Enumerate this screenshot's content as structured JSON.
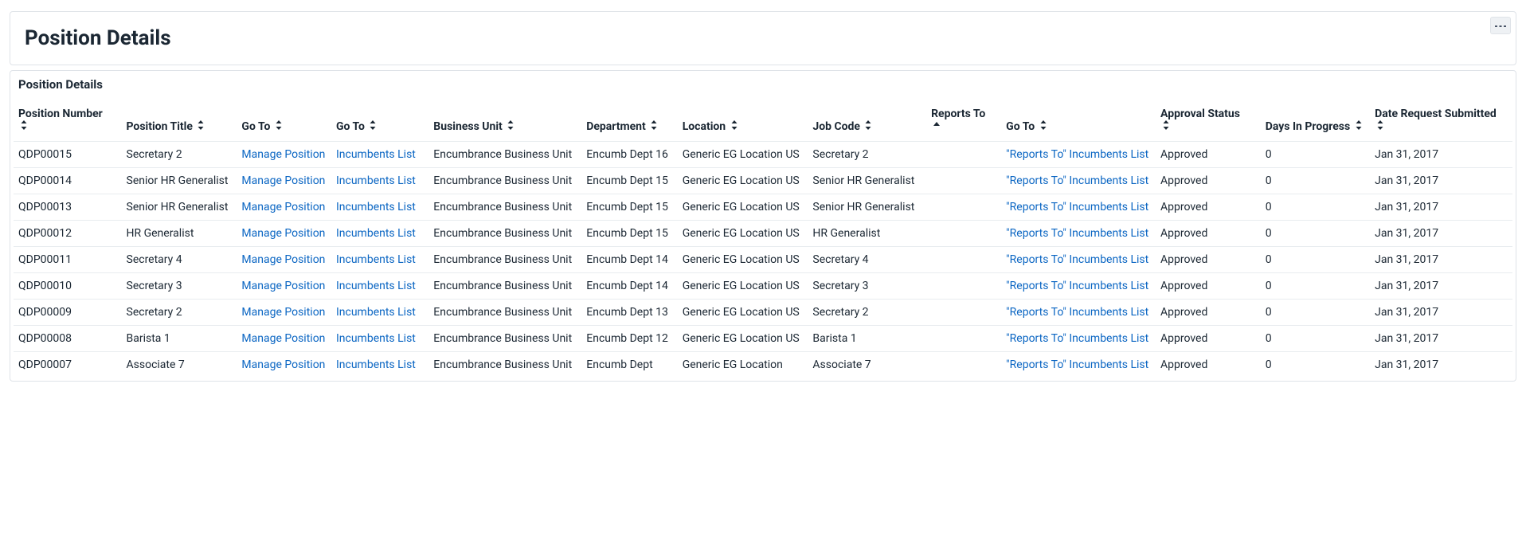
{
  "page": {
    "title": "Position Details",
    "grid_title": "Position Details"
  },
  "columns": [
    {
      "key": "position_number",
      "label": "Position Number",
      "sort": "both",
      "break": true
    },
    {
      "key": "position_title",
      "label": "Position Title",
      "sort": "both"
    },
    {
      "key": "goto1",
      "label": "Go To",
      "sort": "both"
    },
    {
      "key": "goto2",
      "label": "Go To",
      "sort": "both"
    },
    {
      "key": "business_unit",
      "label": "Business Unit",
      "sort": "both"
    },
    {
      "key": "department",
      "label": "Department",
      "sort": "both"
    },
    {
      "key": "location",
      "label": "Location",
      "sort": "both"
    },
    {
      "key": "job_code",
      "label": "Job Code",
      "sort": "both"
    },
    {
      "key": "reports_to",
      "label": "Reports To",
      "sort": "asc",
      "break": true
    },
    {
      "key": "goto3",
      "label": "Go To",
      "sort": "both"
    },
    {
      "key": "approval_status",
      "label": "Approval Status",
      "sort": "both",
      "break": true
    },
    {
      "key": "days_in_progress",
      "label": "Days In Progress",
      "sort": "both"
    },
    {
      "key": "date_submitted",
      "label": "Date Request Submitted",
      "sort": "both"
    }
  ],
  "link_labels": {
    "manage_position": "Manage Position",
    "incumbents_list": "Incumbents List",
    "reports_to_incumbents": "\"Reports To\" Incumbents List"
  },
  "rows": [
    {
      "position_number": "QDP00015",
      "position_title": "Secretary 2",
      "business_unit": "Encumbrance Business Unit",
      "department": "Encumb Dept 16",
      "location": "Generic EG Location US",
      "job_code": "Secretary 2",
      "reports_to": "",
      "approval_status": "Approved",
      "days_in_progress": "0",
      "date_submitted": "Jan 31, 2017"
    },
    {
      "position_number": "QDP00014",
      "position_title": "Senior HR Generalist",
      "business_unit": "Encumbrance Business Unit",
      "department": "Encumb Dept 15",
      "location": "Generic EG Location US",
      "job_code": "Senior HR Generalist",
      "reports_to": "",
      "approval_status": "Approved",
      "days_in_progress": "0",
      "date_submitted": "Jan 31, 2017"
    },
    {
      "position_number": "QDP00013",
      "position_title": "Senior HR Generalist",
      "business_unit": "Encumbrance Business Unit",
      "department": "Encumb Dept 15",
      "location": "Generic EG Location US",
      "job_code": "Senior HR Generalist",
      "reports_to": "",
      "approval_status": "Approved",
      "days_in_progress": "0",
      "date_submitted": "Jan 31, 2017"
    },
    {
      "position_number": "QDP00012",
      "position_title": "HR Generalist",
      "business_unit": "Encumbrance Business Unit",
      "department": "Encumb Dept 15",
      "location": "Generic EG Location US",
      "job_code": "HR Generalist",
      "reports_to": "",
      "approval_status": "Approved",
      "days_in_progress": "0",
      "date_submitted": "Jan 31, 2017"
    },
    {
      "position_number": "QDP00011",
      "position_title": "Secretary 4",
      "business_unit": "Encumbrance Business Unit",
      "department": "Encumb Dept 14",
      "location": "Generic EG Location US",
      "job_code": "Secretary 4",
      "reports_to": "",
      "approval_status": "Approved",
      "days_in_progress": "0",
      "date_submitted": "Jan 31, 2017"
    },
    {
      "position_number": "QDP00010",
      "position_title": "Secretary 3",
      "business_unit": "Encumbrance Business Unit",
      "department": "Encumb Dept 14",
      "location": "Generic EG Location US",
      "job_code": "Secretary 3",
      "reports_to": "",
      "approval_status": "Approved",
      "days_in_progress": "0",
      "date_submitted": "Jan 31, 2017"
    },
    {
      "position_number": "QDP00009",
      "position_title": "Secretary 2",
      "business_unit": "Encumbrance Business Unit",
      "department": "Encumb Dept 13",
      "location": "Generic EG Location US",
      "job_code": "Secretary 2",
      "reports_to": "",
      "approval_status": "Approved",
      "days_in_progress": "0",
      "date_submitted": "Jan 31, 2017"
    },
    {
      "position_number": "QDP00008",
      "position_title": "Barista 1",
      "business_unit": "Encumbrance Business Unit",
      "department": "Encumb Dept 12",
      "location": "Generic EG Location US",
      "job_code": "Barista 1",
      "reports_to": "",
      "approval_status": "Approved",
      "days_in_progress": "0",
      "date_submitted": "Jan 31, 2017"
    },
    {
      "position_number": "QDP00007",
      "position_title": "Associate 7",
      "business_unit": "Encumbrance Business Unit",
      "department": "Encumb Dept",
      "location": "Generic EG Location",
      "job_code": "Associate 7",
      "reports_to": "",
      "approval_status": "Approved",
      "days_in_progress": "0",
      "date_submitted": "Jan 31, 2017"
    }
  ]
}
